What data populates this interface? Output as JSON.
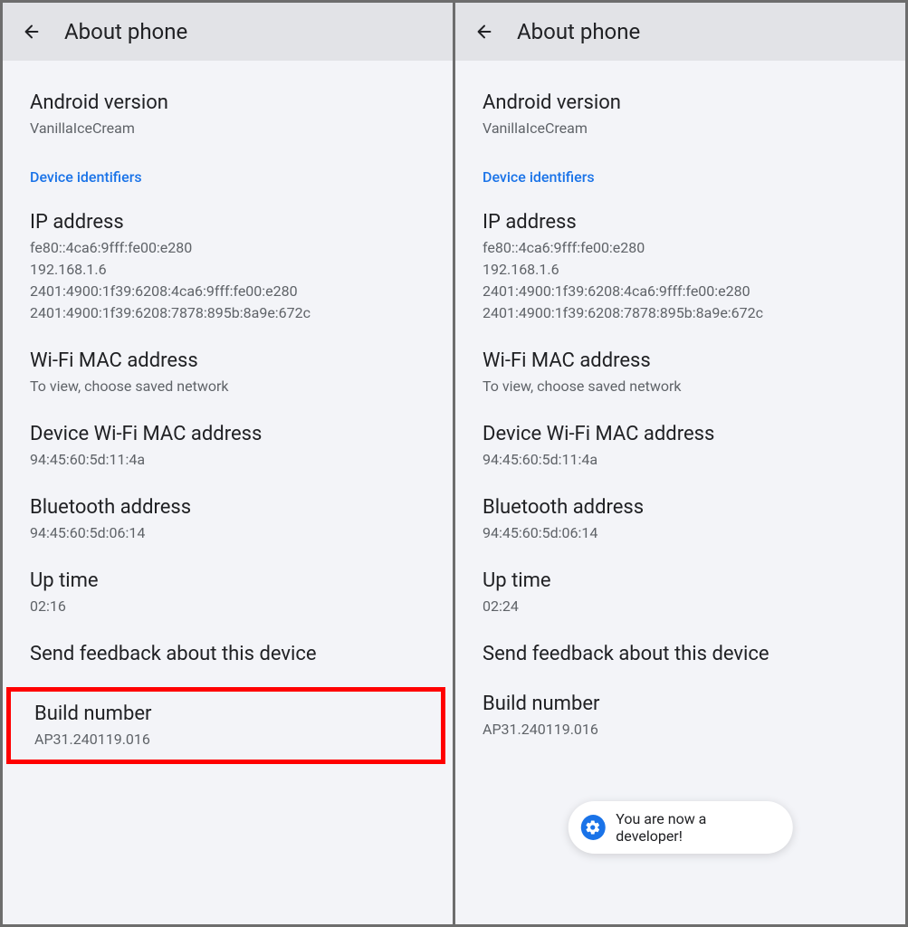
{
  "left": {
    "header_title": "About phone",
    "android_version_label": "Android version",
    "android_version_value": "VanillaIceCream",
    "device_identifiers_label": "Device identifiers",
    "ip_address_label": "IP address",
    "ip_address_value": "fe80::4ca6:9fff:fe00:e280\n192.168.1.6\n2401:4900:1f39:6208:4ca6:9fff:fe00:e280\n2401:4900:1f39:6208:7878:895b:8a9e:672c",
    "wifi_mac_label": "Wi-Fi MAC address",
    "wifi_mac_value": "To view, choose saved network",
    "device_wifi_mac_label": "Device Wi-Fi MAC address",
    "device_wifi_mac_value": "94:45:60:5d:11:4a",
    "bluetooth_label": "Bluetooth address",
    "bluetooth_value": "94:45:60:5d:06:14",
    "uptime_label": "Up time",
    "uptime_value": "02:16",
    "feedback_label": "Send feedback about this device",
    "build_label": "Build number",
    "build_value": "AP31.240119.016"
  },
  "right": {
    "header_title": "About phone",
    "android_version_label": "Android version",
    "android_version_value": "VanillaIceCream",
    "device_identifiers_label": "Device identifiers",
    "ip_address_label": "IP address",
    "ip_address_value": "fe80::4ca6:9fff:fe00:e280\n192.168.1.6\n2401:4900:1f39:6208:4ca6:9fff:fe00:e280\n2401:4900:1f39:6208:7878:895b:8a9e:672c",
    "wifi_mac_label": "Wi-Fi MAC address",
    "wifi_mac_value": "To view, choose saved network",
    "device_wifi_mac_label": "Device Wi-Fi MAC address",
    "device_wifi_mac_value": "94:45:60:5d:11:4a",
    "bluetooth_label": "Bluetooth address",
    "bluetooth_value": "94:45:60:5d:06:14",
    "uptime_label": "Up time",
    "uptime_value": "02:24",
    "feedback_label": "Send feedback about this device",
    "build_label": "Build number",
    "build_value": "AP31.240119.016",
    "toast_text": "You are now a developer!"
  }
}
